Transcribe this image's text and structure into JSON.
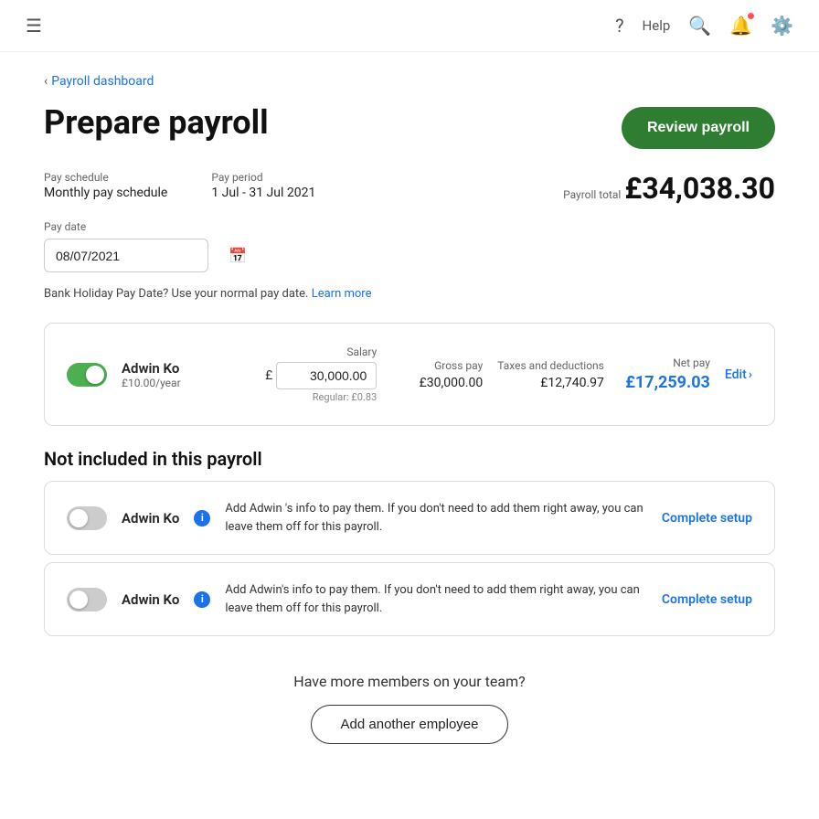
{
  "nav": {
    "help_label": "Help"
  },
  "breadcrumb": {
    "link_text": "Payroll dashboard"
  },
  "page": {
    "title": "Prepare payroll",
    "review_btn": "Review payroll"
  },
  "pay_schedule": {
    "label": "Pay schedule",
    "value": "Monthly pay schedule"
  },
  "pay_period": {
    "label": "Pay period",
    "value": "1 Jul - 31 Jul 2021"
  },
  "payroll_total": {
    "label": "Payroll total",
    "value": "£34,038.30"
  },
  "pay_date": {
    "label": "Pay date",
    "value": "08/07/2021"
  },
  "bank_holiday": {
    "text": "Bank Holiday Pay Date? Use your normal pay date.",
    "learn_more": "Learn more"
  },
  "included_employee": {
    "name": "Adwin Ko",
    "rate": "£10.00/year",
    "salary_label": "Salary",
    "salary_value": "30,000.00",
    "regular_text": "Regular: £0.83",
    "gross_pay_label": "Gross pay",
    "gross_pay_value": "£30,000.00",
    "taxes_label": "Taxes and deductions",
    "taxes_value": "£12,740.97",
    "net_pay_label": "Net pay",
    "net_pay_value": "£17,259.03",
    "edit_label": "Edit"
  },
  "not_included_section": {
    "title": "Not included in this payroll",
    "employees": [
      {
        "name": "Adwin Ko",
        "info_text": "Add Adwin 's info to pay them. If you don't need to add them right away, you can leave them off for this payroll.",
        "action": "Complete setup"
      },
      {
        "name": "Adwin Ko",
        "info_text": "Add Adwin's info to pay them. If you don't need to add them right away, you can leave them off for this payroll.",
        "action": "Complete setup"
      }
    ]
  },
  "bottom": {
    "question": "Have more members on your team?",
    "add_btn": "Add another employee"
  }
}
